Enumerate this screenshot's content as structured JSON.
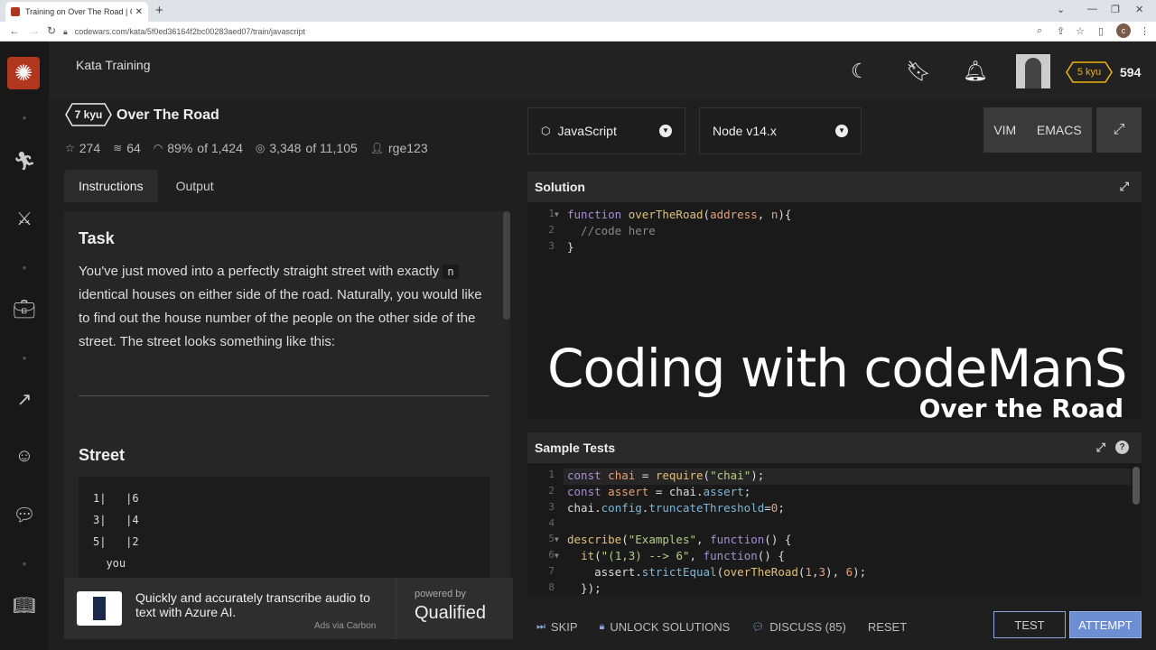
{
  "browser": {
    "tab_title": "Training on Over The Road | Codewars",
    "url": "codewars.com/kata/5f0ed36164f2bc00283aed07/train/javascript",
    "profile_initial": "c"
  },
  "topbar": {
    "title": "Kata Training",
    "rank": "5 kyu",
    "honor": "594"
  },
  "kata": {
    "rank": "7 kyu",
    "title": "Over The Road",
    "stats": {
      "stars": "274",
      "collections": "64",
      "satisfaction": "89%",
      "satisfaction_of": "of 1,424",
      "completed": "3,348",
      "completed_of": "of 11,105",
      "author": "rge123"
    },
    "tabs": [
      "Instructions",
      "Output"
    ],
    "task_heading": "Task",
    "task_text_1": "You've just moved into a perfectly straight street with exactly",
    "task_code": "n",
    "task_text_2": "identical houses on either side of the road. Naturally, you would like to find out the house number of the people on the other side of the street. The street looks something like this:",
    "street_heading": "Street",
    "street_lines": [
      "1|   |6",
      "3|   |4",
      "5|   |2",
      "  you"
    ]
  },
  "ad": {
    "text": "Quickly and accurately transcribe audio to text with Azure AI.",
    "powered": "powered by",
    "brand": "Qualified",
    "via": "Ads via Carbon"
  },
  "editor": {
    "language": "JavaScript",
    "version": "Node v14.x",
    "modes": [
      "VIM",
      "EMACS"
    ],
    "solution_title": "Solution",
    "tests_title": "Sample Tests"
  },
  "watermark": {
    "line1": "Coding with codeManS",
    "line2": "Over the Road"
  },
  "actions": {
    "skip": "SKIP",
    "unlock": "UNLOCK SOLUTIONS",
    "discuss": "DISCUSS (85)",
    "reset": "RESET",
    "test": "TEST",
    "attempt": "ATTEMPT"
  },
  "colors": {
    "brand": "#b1361e",
    "accent": "#6e8ed4",
    "rank_yellow": "#ecb613"
  },
  "icons": [
    "codewars-logo-icon",
    "training-icon",
    "martial-arts-icon",
    "briefcase-icon",
    "trending-icon",
    "discord-icon",
    "chat-icon",
    "book-icon",
    "moon-icon",
    "bookmark-icon",
    "bell-icon"
  ]
}
